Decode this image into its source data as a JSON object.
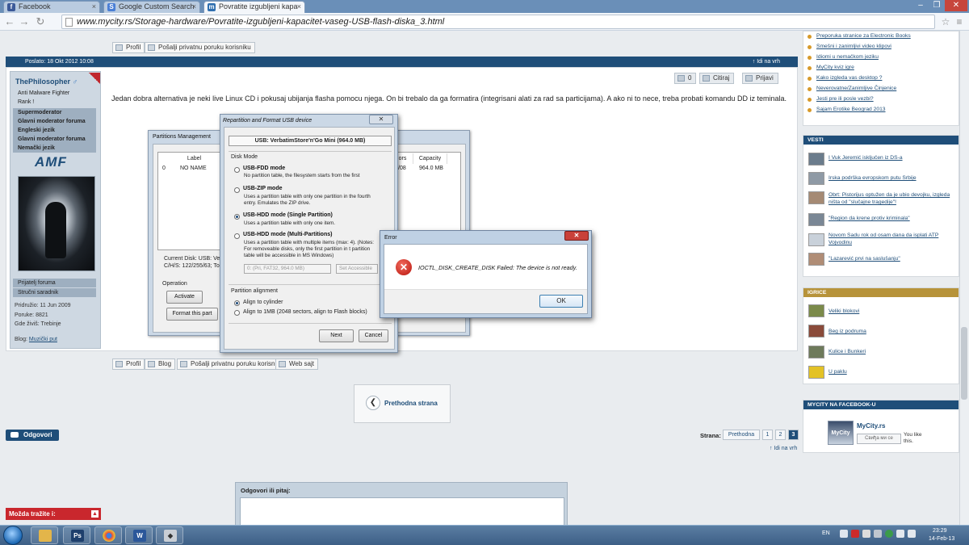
{
  "browser": {
    "tabs": [
      {
        "label": "Facebook",
        "active": false
      },
      {
        "label": "Google Custom Search",
        "active": false
      },
      {
        "label": "Povratite izgubljeni kapa",
        "active": true
      }
    ],
    "url": "www.mycity.rs/Storage-hardware/Povratite-izgubljeni-kapacitet-vaseg-USB-flash-diska_3.html"
  },
  "post": {
    "top_buttons": [
      "Profil",
      "Pošalji privatnu poruku korisniku"
    ],
    "posted": "Poslato: 18 Okt 2012 10:08",
    "to_top": "Idi na vrh",
    "actions": {
      "likes": "0",
      "quote": "Citiraj",
      "report": "Prijavi"
    },
    "text": "Jedan dobra alternativa je neki live Linux CD i pokusaj ubijanja flasha pomocu njega. On bi trebalo da ga formatira (integrisani alati za rad sa particijama). A ako ni to nece, treba probati komandu DD iz teminala.",
    "bottom_buttons": [
      "Profil",
      "Blog",
      "Pošalji privatnu poruku korisniku",
      "Web sajt"
    ]
  },
  "user": {
    "name": "ThePhilosopher",
    "roles": [
      "Anti Malware Fighter",
      "Rank !",
      "Supermoderator",
      "Glavni moderator foruma",
      "Engleski jezik",
      "Glavni moderator foruma",
      "Nemački jezik"
    ],
    "badge": "AMF",
    "links": [
      "Prijatelj foruma",
      "Stručni saradnik"
    ],
    "joined": "Pridružio: 11 Jun 2009",
    "posts": "Poruke: 8821",
    "location": "Gde živiš: Trebinje",
    "blog_label": "Blog:",
    "blog": "Muzički put"
  },
  "partitions_window": {
    "title": "Partitions Management",
    "columns": [
      "Label",
      "ors",
      "Capacity"
    ],
    "row": {
      "index": "0",
      "label": "NO NAME",
      "sectors": "/08",
      "capacity": "964.0 MB"
    },
    "current_disk": "Current Disk:   USB: Ve",
    "chs": "C/H/S: 122/255/63; To",
    "operation_label": "Operation",
    "buttons": [
      "Activate",
      "Format this part"
    ]
  },
  "repartition_dialog": {
    "title": "Repartition and Format USB device",
    "device": "USB: VerbatimStore'n'Go Mini (964.0 MB)",
    "disk_mode_label": "Disk Mode",
    "modes": [
      {
        "name": "USB-FDD mode",
        "desc": "No partition table, the filesystem starts from the first",
        "selected": false
      },
      {
        "name": "USB-ZIP mode",
        "desc": "Uses a partition table with only one partition in the fourth entry. Emulates the ZIP drive.",
        "selected": false
      },
      {
        "name": "USB-HDD mode (Single Partition)",
        "desc": "Uses a partition table with only one item.",
        "selected": true
      },
      {
        "name": "USB-HDD mode (Multi-Partitions)",
        "desc": "Uses a partition table with multiple items (max: 4). (Notes: For removeable disks, only the first partition in t partition table will be accessible in MS Windows)",
        "selected": false
      }
    ],
    "partition_select": "0: (Pri, FAT32, 964.0 MB)",
    "set_accessible": "Set Accessible",
    "alignment_label": "Partition alignment",
    "alignments": [
      {
        "label": "Align to cylinder",
        "selected": true
      },
      {
        "label": "Align to 1MB (2048 sectors, align to Flash blocks)",
        "selected": false
      }
    ],
    "next": "Next",
    "cancel": "Cancel"
  },
  "error_dialog": {
    "title": "Error",
    "message": "IOCTL_DISK_CREATE_DISK Failed: The device is not ready.",
    "ok": "OK"
  },
  "below": {
    "prev": "Prethodna strana",
    "reply": "Odgovori",
    "page_label": "Strana:",
    "pages": [
      "Prethodna",
      "1",
      "2",
      "3"
    ],
    "current_page": "3",
    "to_top": "Idi na vrh",
    "quick_reply": "Odgovori ili pitaj:",
    "maybe": "Možda tražite i:"
  },
  "sidebar": {
    "top_links": [
      "Preporuka stranice za Electronic Books",
      "Smešni i zanimljivi video klipovi",
      "Idiomi u nemačkom jeziku",
      "MyCity kviz igre",
      "Kako izgleda vas desktop ?",
      "Neverovatne/Zanimljive Činjenice",
      "Jesti pre ili posle vezbi?",
      "Sajam Erotike Beograd 2013"
    ],
    "news_title": "VESTI",
    "news": [
      "I Vuk Jeremić isključen iz DS-a",
      "Irska podrška evropskom putu Srbije",
      "Obrt: Pistorijus optužen da je ubio devojku, izgleda ništa od \"slučajne tragedije\"!",
      "\"Region da krene protiv kriminala\"",
      "Novom Sadu rok od osam dana da isplati ATP Vojvodinu",
      "\"Lazarević prvi na saslušanju\""
    ],
    "games_title": "IGRICE",
    "games": [
      "Veliki blokovi",
      "Beg iz podruma",
      "Kulice i Bunkeri",
      "U paklu"
    ],
    "fb_title": "MYCITY NA FACEBOOK-U",
    "fb_name": "MyCity.rs",
    "fb_like": "Свиђа ми се",
    "fb_likes": "You like this."
  },
  "taskbar": {
    "lang": "EN",
    "time": "23:29",
    "date": "14-Feb-13"
  },
  "colors": {
    "accent": "#1f4e79",
    "error": "#b8140c",
    "page_bg": "#e9ecef"
  }
}
